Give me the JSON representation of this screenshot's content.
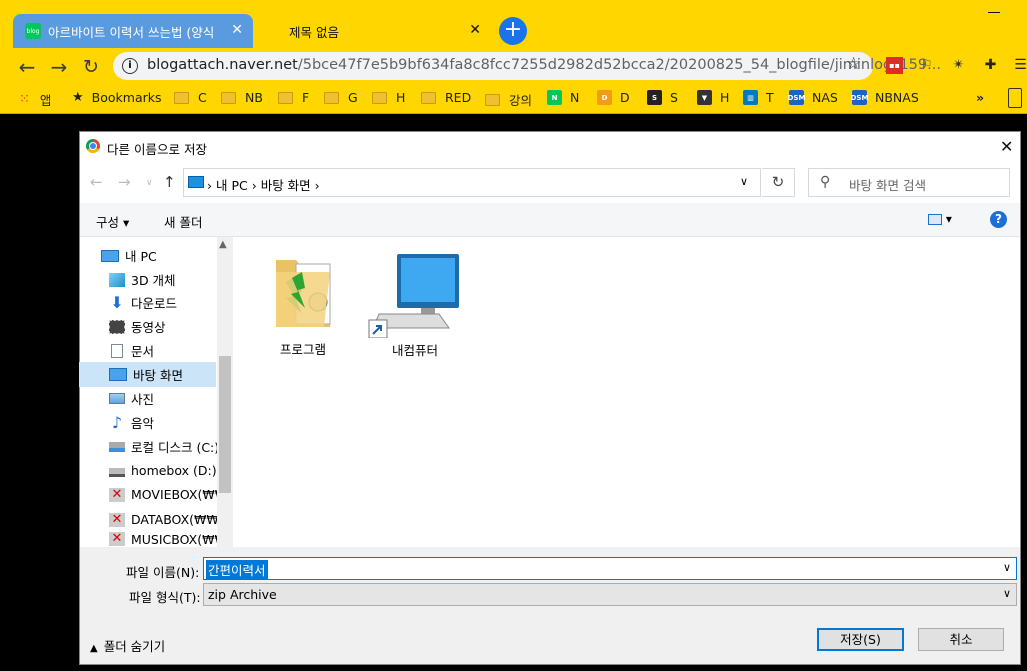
{
  "browser": {
    "tabs": [
      {
        "favicon": "blog",
        "label": "아르바이트 이력서 쓰는법 (양식",
        "active": false
      },
      {
        "label": "제목 없음",
        "active": true
      }
    ],
    "url": {
      "host": "blogattach.naver.net",
      "path": "/5bce47f7e5b9bf634fa8c8fcc7255d2982d52bcca2/20200825_54_blogfile/jiminlog_159..."
    },
    "bookmarks": {
      "apps_label": "앱",
      "items": [
        "Bookmarks",
        "C",
        "NB",
        "F",
        "G",
        "H",
        "RED",
        "강의",
        "N",
        "D",
        "S",
        "H",
        "T",
        "NAS",
        "NBNAS"
      ],
      "overflow": "»"
    },
    "colors": {
      "accent": "#ffd600",
      "tab_active_bg": "#5a9be0"
    }
  },
  "dialog": {
    "title": "다른 이름으로 저장",
    "address": {
      "root": "내 PC",
      "sep": "›",
      "folder": "바탕 화면"
    },
    "search_placeholder": "바탕 화면 검색",
    "commands": {
      "organize": "구성 ▾",
      "new_folder": "새 폴더",
      "view": "▾"
    },
    "tree": [
      {
        "icon": "pc-icon",
        "label": "내 PC"
      },
      {
        "icon": "3d-objects-icon",
        "label": "3D 개체"
      },
      {
        "icon": "downloads-icon",
        "label": "다운로드"
      },
      {
        "icon": "videos-icon",
        "label": "동영상"
      },
      {
        "icon": "documents-icon",
        "label": "문서"
      },
      {
        "icon": "desktop-icon",
        "label": "바탕 화면",
        "selected": true
      },
      {
        "icon": "pictures-icon",
        "label": "사진"
      },
      {
        "icon": "music-icon",
        "label": "음악"
      },
      {
        "icon": "local-disk-icon",
        "label": "로컬 디스크 (C:)"
      },
      {
        "icon": "drive-icon",
        "label": "homebox (D:)"
      },
      {
        "icon": "network-drive-disconnected-icon",
        "label": "MOVIEBOX(₩₩F"
      },
      {
        "icon": "network-drive-disconnected-icon",
        "label": "DATABOX(₩₩RE"
      },
      {
        "icon": "network-drive-disconnected-icon",
        "label": "MUSICBOX(₩₩F"
      }
    ],
    "files": [
      {
        "icon": "program-folder-icon",
        "label": "프로그램"
      },
      {
        "icon": "computer-shortcut-icon",
        "label": "내컴퓨터"
      }
    ],
    "filename_label": "파일 이름(N):",
    "filename_value": "간편이력서",
    "filetype_label": "파일 형식(T):",
    "filetype_value": "zip Archive",
    "hide_folders": "폴더 숨기기",
    "save_label": "저장(S)",
    "cancel_label": "취소"
  }
}
